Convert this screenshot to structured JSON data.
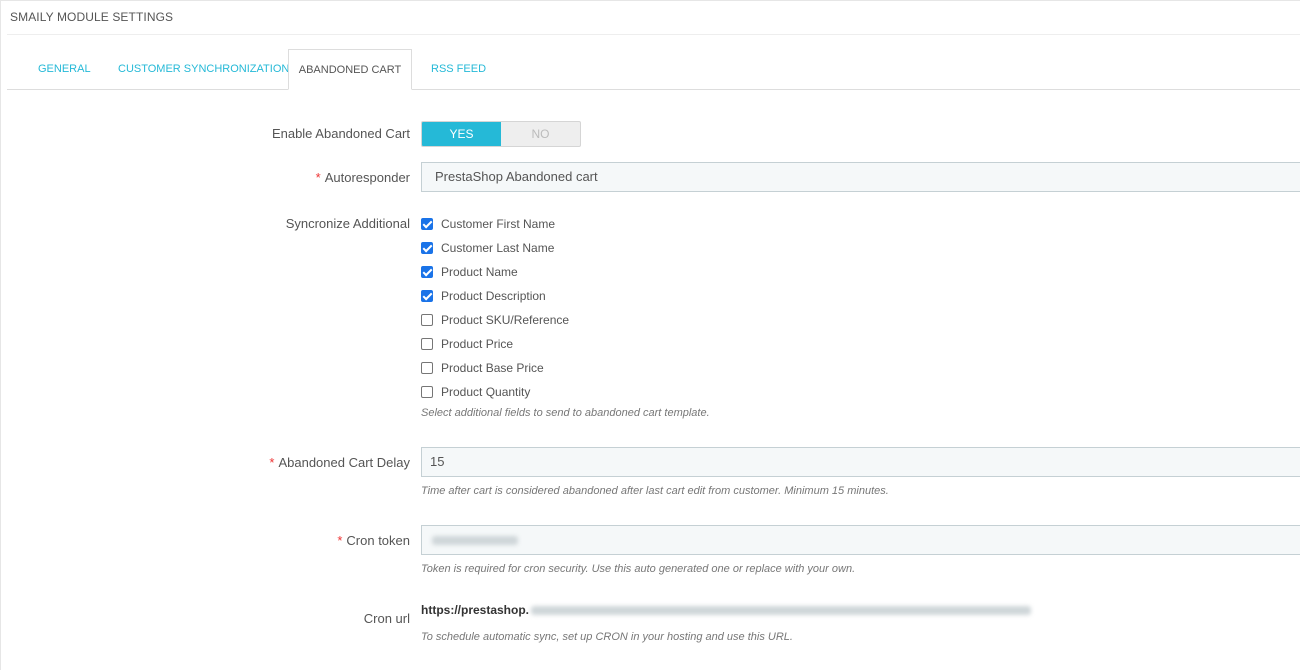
{
  "panel": {
    "title": "SMAILY MODULE SETTINGS"
  },
  "tabs": [
    {
      "label": "GENERAL",
      "active": false
    },
    {
      "label": "CUSTOMER SYNCHRONIZATION",
      "active": false
    },
    {
      "label": "ABANDONED CART",
      "active": true
    },
    {
      "label": "RSS FEED",
      "active": false
    }
  ],
  "enable": {
    "label": "Enable Abandoned Cart",
    "yes": "YES",
    "no": "NO",
    "value": "YES"
  },
  "autoresponder": {
    "required": "*",
    "label": "Autoresponder",
    "value": "PrestaShop Abandoned cart"
  },
  "sync": {
    "label": "Syncronize Additional",
    "options": [
      {
        "label": "Customer First Name",
        "checked": true
      },
      {
        "label": "Customer Last Name",
        "checked": true
      },
      {
        "label": "Product Name",
        "checked": true
      },
      {
        "label": "Product Description",
        "checked": true
      },
      {
        "label": "Product SKU/Reference",
        "checked": false
      },
      {
        "label": "Product Price",
        "checked": false
      },
      {
        "label": "Product Base Price",
        "checked": false
      },
      {
        "label": "Product Quantity",
        "checked": false
      }
    ],
    "help": "Select additional fields to send to abandoned cart template."
  },
  "delay": {
    "required": "*",
    "label": "Abandoned Cart Delay",
    "value": "15",
    "help": "Time after cart is considered abandoned after last cart edit from customer. Minimum 15 minutes."
  },
  "token": {
    "required": "*",
    "label": "Cron token",
    "help": "Token is required for cron security. Use this auto generated one or replace with your own."
  },
  "cron": {
    "label": "Cron url",
    "url_prefix": "https://prestashop.",
    "help": "To schedule automatic sync, set up CRON in your hosting and use this URL."
  },
  "colors": {
    "accent": "#25b9d7",
    "required": "#ee3333",
    "checkbox": "#1a73e8"
  }
}
